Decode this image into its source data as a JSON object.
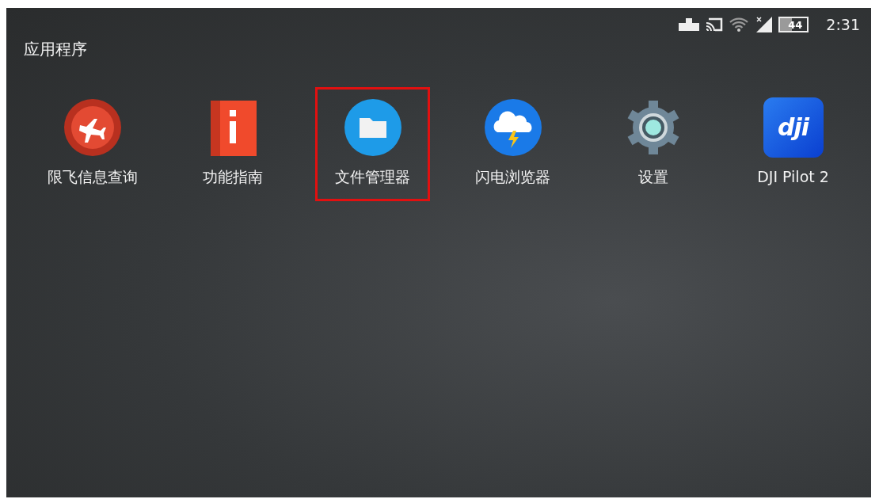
{
  "status_bar": {
    "battery": {
      "text": "44",
      "level": 0.44
    },
    "time": "2:31"
  },
  "drawer": {
    "title": "应用程序"
  },
  "apps": [
    {
      "label": "限飞信息查询",
      "kind": "plane",
      "highlighted": false
    },
    {
      "label": "功能指南",
      "kind": "guide",
      "highlighted": false
    },
    {
      "label": "文件管理器",
      "kind": "folder",
      "highlighted": true
    },
    {
      "label": "闪电浏览器",
      "kind": "weather",
      "highlighted": false
    },
    {
      "label": "设置",
      "kind": "settings",
      "highlighted": false
    },
    {
      "label": "DJI Pilot 2",
      "kind": "logo",
      "logo_text": "dji",
      "highlighted": false
    }
  ]
}
